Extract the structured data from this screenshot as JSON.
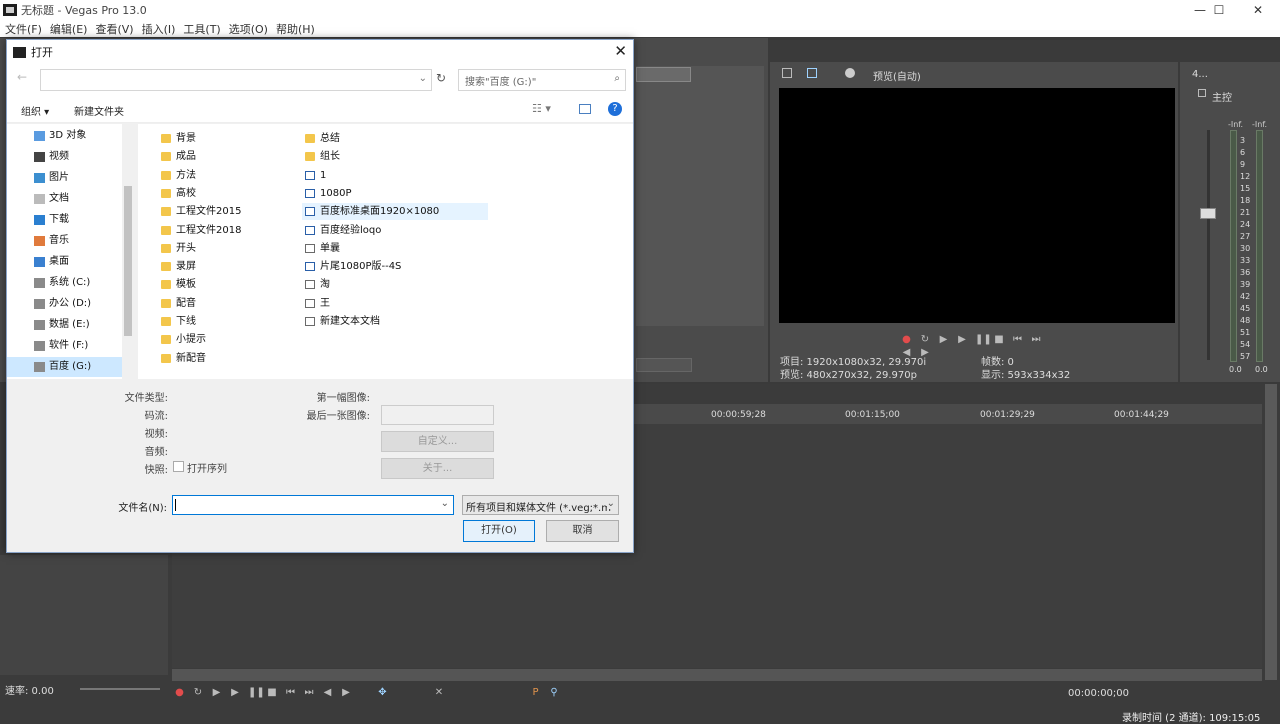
{
  "window": {
    "title": "无标题 - Vegas Pro 13.0",
    "minimize_icon": "—",
    "maximize_icon": "☐",
    "close_icon": "✕"
  },
  "menu": [
    "文件(F)",
    "编辑(E)",
    "查看(V)",
    "插入(I)",
    "工具(T)",
    "选项(O)",
    "帮助(H)"
  ],
  "preview": {
    "mode_label": "预览(自动)",
    "project_info": "项目: 1920x1080x32, 29.970i",
    "frame_label": "帧数: 0",
    "preview_info": "预览: 480x270x32, 29.970p",
    "display_info": "显示: 593x334x32"
  },
  "mixer": {
    "title": "主控",
    "panel_num": "4...",
    "inf_left": "-Inf.",
    "inf_right": "-Inf.",
    "scale": [
      "3",
      "6",
      "9",
      "12",
      "15",
      "18",
      "21",
      "24",
      "27",
      "30",
      "33",
      "36",
      "39",
      "42",
      "45",
      "48",
      "51",
      "54",
      "57"
    ],
    "bottom_left": "0.0",
    "bottom_right": "0.0"
  },
  "timeline": {
    "ruler": [
      "00:00:59;28",
      "00:01:15;00",
      "00:01:29;29",
      "00:01:44;29"
    ],
    "rate_label": "速率: 0.00",
    "timecode": "00:00:00;00",
    "record_time": "录制时间 (2 通道): 109:15:05"
  },
  "dialog": {
    "title": "打开",
    "search_placeholder": "搜索\"百度 (G:)\"",
    "organize_label": "组织 ▾",
    "new_folder_label": "新建文件夹",
    "tree": [
      {
        "label": "3D 对象",
        "icon": "3d-objects-icon",
        "selected": false
      },
      {
        "label": "视频",
        "icon": "videos-icon",
        "selected": false
      },
      {
        "label": "图片",
        "icon": "pictures-icon",
        "selected": false
      },
      {
        "label": "文档",
        "icon": "documents-icon",
        "selected": false
      },
      {
        "label": "下载",
        "icon": "downloads-icon",
        "selected": false
      },
      {
        "label": "音乐",
        "icon": "music-icon",
        "selected": false
      },
      {
        "label": "桌面",
        "icon": "desktop-icon",
        "selected": false
      },
      {
        "label": "系统 (C:)",
        "icon": "drive-icon",
        "selected": false
      },
      {
        "label": "办公 (D:)",
        "icon": "drive-icon",
        "selected": false
      },
      {
        "label": "数据 (E:)",
        "icon": "drive-icon",
        "selected": false
      },
      {
        "label": "软件 (F:)",
        "icon": "drive-icon",
        "selected": false
      },
      {
        "label": "百度 (G:)",
        "icon": "drive-icon",
        "selected": true
      }
    ],
    "files_col1": [
      "背景",
      "成品",
      "方法",
      "高校",
      "工程文件2015",
      "工程文件2018",
      "开头",
      "录屏",
      "模板",
      "配音",
      "下线",
      "小提示",
      "新配音"
    ],
    "files_col2": [
      {
        "name": "总结",
        "type": "folder"
      },
      {
        "name": "组长",
        "type": "folder"
      },
      {
        "name": "1",
        "type": "media"
      },
      {
        "name": "1080P",
        "type": "image"
      },
      {
        "name": "百度标准桌面1920×1080",
        "type": "image"
      },
      {
        "name": "百度经验loqo",
        "type": "image"
      },
      {
        "name": "单曩",
        "type": "doc"
      },
      {
        "name": "片尾1080P版--4S",
        "type": "image"
      },
      {
        "name": "淘",
        "type": "doc"
      },
      {
        "name": "王",
        "type": "doc"
      },
      {
        "name": "新建文本文档",
        "type": "doc"
      }
    ],
    "info_labels": {
      "file_type": "文件类型:",
      "stream": "码流:",
      "video": "视频:",
      "audio": "音频:",
      "snapshot": "快照:",
      "open_seq": "打开序列",
      "first_image": "第一幅图像:",
      "last_image": "最后一张图像:",
      "custom_btn": "自定义...",
      "about_btn": "关于..."
    },
    "filename_label": "文件名(N):",
    "filename_value": "",
    "filetype_value": "所有项目和媒体文件 (*.veg;*.m",
    "open_btn": "打开(O)",
    "cancel_btn": "取消"
  },
  "colors": {
    "accent": "#0078d7",
    "folder": "#f3c64b",
    "record": "#e24c4c"
  }
}
